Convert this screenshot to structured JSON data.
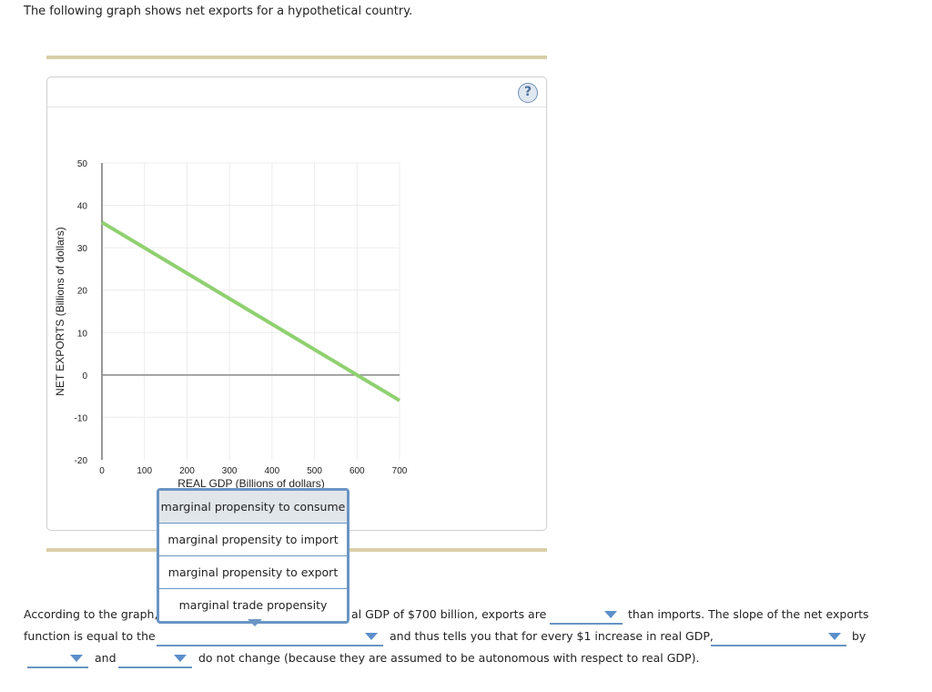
{
  "intro_text": "The following graph shows net exports for a hypothetical country.",
  "help_button": {
    "icon": "question-mark-icon",
    "label": "?"
  },
  "chart_data": {
    "type": "line",
    "title": "",
    "xlabel": "REAL GDP (Billions of dollars)",
    "ylabel": "NET EXPORTS (Billions of dollars)",
    "xlim": [
      0,
      700
    ],
    "ylim": [
      -20,
      50
    ],
    "x_ticks": [
      0,
      100,
      200,
      300,
      400,
      500,
      600,
      700
    ],
    "y_ticks": [
      50,
      40,
      30,
      20,
      10,
      0,
      -10,
      -20
    ],
    "grid": true,
    "series": [
      {
        "name": "Net exports",
        "color": "#90d070",
        "x": [
          0,
          600,
          700
        ],
        "y": [
          36,
          0,
          -6
        ]
      }
    ],
    "reference_line": {
      "y": 0,
      "color": "#888888"
    }
  },
  "dropdown": {
    "options": [
      "marginal propensity to consume",
      "marginal propensity to import",
      "marginal propensity to export",
      "marginal trade propensity"
    ],
    "highlighted_index": 0
  },
  "question": {
    "line1_a": "According to the graph,",
    "line1_b": "al GDP of $700 billion, exports are",
    "line1_c": "than imports. The slope of the net exports",
    "line2_a": "function is equal to the",
    "line2_b": "and thus tells you that for every $1 increase in real GDP,",
    "line2_c": "by",
    "line3_a": "and",
    "line3_b": "do not change (because they are assumed to be autonomous with respect to real GDP).",
    "selects": [
      {
        "name": "exports-comparison-select",
        "value": ""
      },
      {
        "name": "slope-equal-to-select",
        "value": ""
      },
      {
        "name": "change-quantity-select",
        "value": ""
      },
      {
        "name": "change-amount-select",
        "value": ""
      },
      {
        "name": "constant-item-select",
        "value": ""
      }
    ]
  },
  "accent_color": "#6a95c4",
  "divider_color": "#d8cfa8"
}
